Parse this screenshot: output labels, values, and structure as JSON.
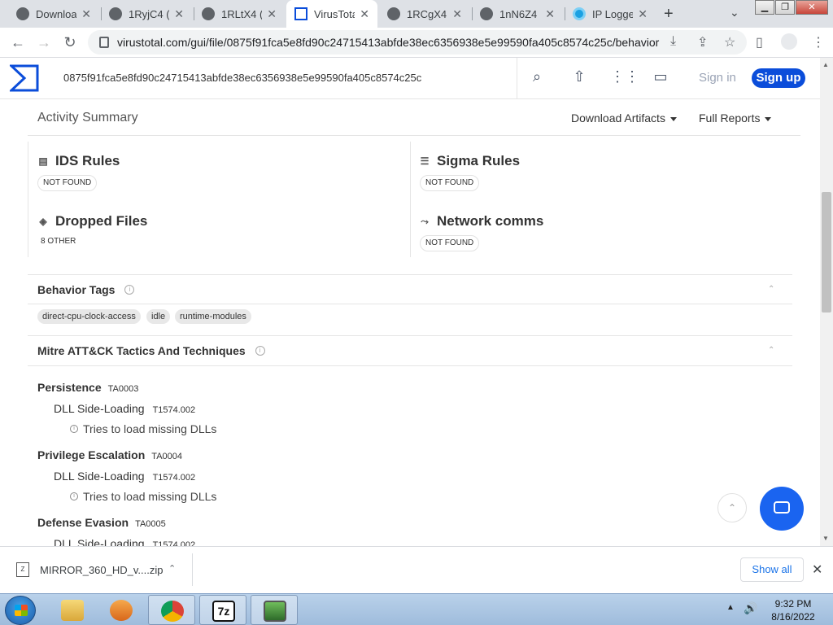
{
  "browser": {
    "tabs": [
      {
        "label": "Downloa",
        "icon": "vt-icon"
      },
      {
        "label": "1RyjC4 (",
        "icon": "globe-icon"
      },
      {
        "label": "1RLtX4 (",
        "icon": "globe-icon"
      },
      {
        "label": "VirusTota",
        "icon": "vt-icon",
        "active": true
      },
      {
        "label": "1RCgX4 (",
        "icon": "globe-icon"
      },
      {
        "label": "1nN6Z4",
        "icon": "globe-icon"
      },
      {
        "label": "IP Logge",
        "icon": "iplogger-icon"
      }
    ],
    "url": "virustotal.com/gui/file/0875f91fca5e8fd90c24715413abfde38ec6356938e5e99590fa405c8574c25c/behavior"
  },
  "vt": {
    "search_value": "0875f91fca5e8fd90c24715413abfde38ec6356938e5e99590fa405c8574c25c",
    "signin": "Sign in",
    "signup": "Sign up",
    "accent": "#0b4dda"
  },
  "activity": {
    "title": "Activity Summary",
    "download_artifacts": "Download Artifacts",
    "full_reports": "Full Reports",
    "cells": [
      {
        "title": "IDS Rules",
        "badge": "NOT FOUND"
      },
      {
        "title": "Sigma Rules",
        "badge": "NOT FOUND"
      },
      {
        "title": "Dropped Files",
        "badge": "8 OTHER"
      },
      {
        "title": "Network comms",
        "badge": "NOT FOUND"
      }
    ]
  },
  "behavior_tags": {
    "title": "Behavior Tags",
    "tags": [
      "direct-cpu-clock-access",
      "idle",
      "runtime-modules"
    ]
  },
  "mitre": {
    "title": "Mitre ATT&CK Tactics And Techniques",
    "tactics": [
      {
        "name": "Persistence",
        "id": "TA0003",
        "technique": "DLL Side-Loading",
        "tech_id": "T1574.002",
        "signature": "Tries to load missing DLLs"
      },
      {
        "name": "Privilege Escalation",
        "id": "TA0004",
        "technique": "DLL Side-Loading",
        "tech_id": "T1574.002",
        "signature": "Tries to load missing DLLs"
      },
      {
        "name": "Defense Evasion",
        "id": "TA0005",
        "technique": "DLL Side-Loading",
        "tech_id": "T1574.002"
      }
    ]
  },
  "download_bar": {
    "file": "MIRROR_360_HD_v....zip",
    "show_all": "Show all"
  },
  "taskbar": {
    "time": "9:32 PM",
    "date": "8/16/2022"
  }
}
